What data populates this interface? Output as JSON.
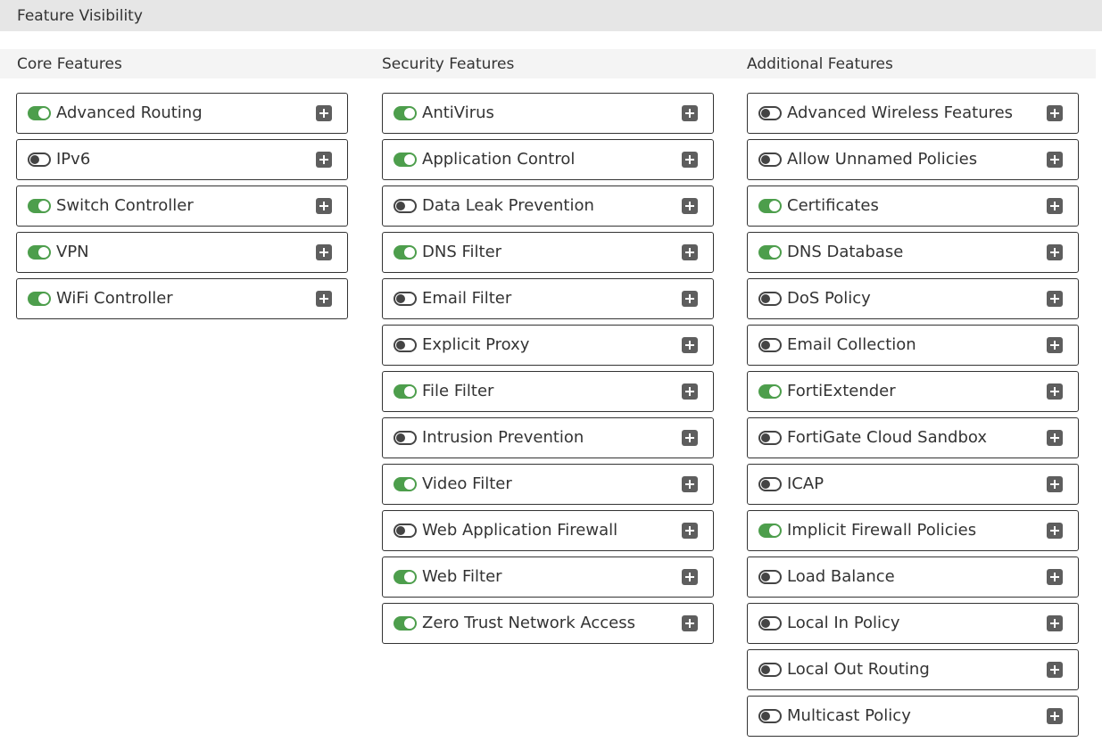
{
  "header": {
    "title": "Feature Visibility"
  },
  "columns": [
    {
      "title": "Core Features",
      "items": [
        {
          "label": "Advanced Routing",
          "enabled": true
        },
        {
          "label": "IPv6",
          "enabled": false
        },
        {
          "label": "Switch Controller",
          "enabled": true
        },
        {
          "label": "VPN",
          "enabled": true
        },
        {
          "label": "WiFi Controller",
          "enabled": true
        }
      ]
    },
    {
      "title": "Security Features",
      "items": [
        {
          "label": "AntiVirus",
          "enabled": true
        },
        {
          "label": "Application Control",
          "enabled": true
        },
        {
          "label": "Data Leak Prevention",
          "enabled": false
        },
        {
          "label": "DNS Filter",
          "enabled": true
        },
        {
          "label": "Email Filter",
          "enabled": false
        },
        {
          "label": "Explicit Proxy",
          "enabled": false
        },
        {
          "label": "File Filter",
          "enabled": true
        },
        {
          "label": "Intrusion Prevention",
          "enabled": false
        },
        {
          "label": "Video Filter",
          "enabled": true
        },
        {
          "label": "Web Application Firewall",
          "enabled": false
        },
        {
          "label": "Web Filter",
          "enabled": true
        },
        {
          "label": "Zero Trust Network Access",
          "enabled": true
        }
      ]
    },
    {
      "title": "Additional Features",
      "items": [
        {
          "label": "Advanced Wireless Features",
          "enabled": false
        },
        {
          "label": "Allow Unnamed Policies",
          "enabled": false
        },
        {
          "label": "Certificates",
          "enabled": true
        },
        {
          "label": "DNS Database",
          "enabled": true
        },
        {
          "label": "DoS Policy",
          "enabled": false
        },
        {
          "label": "Email Collection",
          "enabled": false
        },
        {
          "label": "FortiExtender",
          "enabled": true
        },
        {
          "label": "FortiGate Cloud Sandbox",
          "enabled": false
        },
        {
          "label": "ICAP",
          "enabled": false
        },
        {
          "label": "Implicit Firewall Policies",
          "enabled": true
        },
        {
          "label": "Load Balance",
          "enabled": false
        },
        {
          "label": "Local In Policy",
          "enabled": false
        },
        {
          "label": "Local Out Routing",
          "enabled": false
        },
        {
          "label": "Multicast Policy",
          "enabled": false
        }
      ]
    }
  ],
  "icons": {
    "toggle": "toggle-switch-icon",
    "expand": "plus-square-icon"
  },
  "colors": {
    "toggle_on": "#4d9e4c",
    "toggle_off": "#444444",
    "header_bg": "#e6e6e6"
  }
}
